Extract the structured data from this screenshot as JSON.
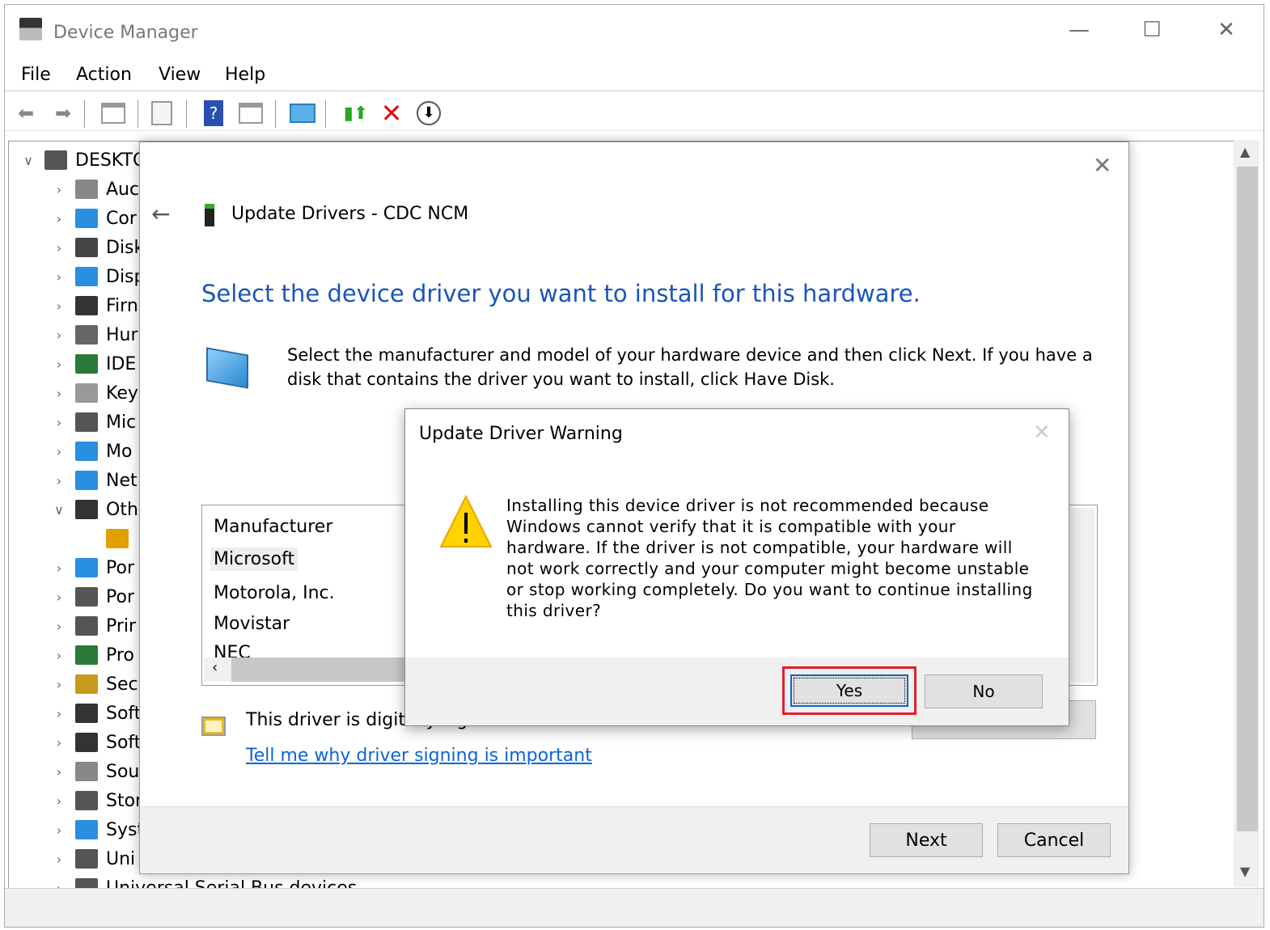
{
  "window": {
    "title": "Device Manager",
    "minimize": "—",
    "maximize": "☐",
    "close": "✕"
  },
  "menu": [
    "File",
    "Action",
    "View",
    "Help"
  ],
  "toolbar": {
    "icons": [
      "back-icon",
      "forward-icon",
      "show-hide-console-tree-icon",
      "properties-icon",
      "help-icon",
      "action-pane-icon",
      "scan-hardware-icon",
      "update-driver-icon",
      "uninstall-device-icon",
      "disable-device-icon"
    ]
  },
  "tree": {
    "root": "DESKTO",
    "items": [
      {
        "label": "Auc",
        "icon": "audio-icon",
        "color": "#888",
        "expanded": false
      },
      {
        "label": "Cor",
        "icon": "computer-icon",
        "color": "#2a8fe0",
        "expanded": false
      },
      {
        "label": "Disk",
        "icon": "disk-icon",
        "color": "#444",
        "expanded": false
      },
      {
        "label": "Disp",
        "icon": "display-icon",
        "color": "#2a8fe0",
        "expanded": false
      },
      {
        "label": "Firn",
        "icon": "firmware-icon",
        "color": "#333",
        "expanded": false
      },
      {
        "label": "Hur",
        "icon": "hid-icon",
        "color": "#666",
        "expanded": false
      },
      {
        "label": "IDE",
        "icon": "ide-icon",
        "color": "#2a7a3a",
        "expanded": false
      },
      {
        "label": "Key",
        "icon": "keyboard-icon",
        "color": "#999",
        "expanded": false
      },
      {
        "label": "Mic",
        "icon": "mouse-icon",
        "color": "#555",
        "expanded": false
      },
      {
        "label": "Mo",
        "icon": "monitor-icon",
        "color": "#2a8fe0",
        "expanded": false
      },
      {
        "label": "Net",
        "icon": "network-icon",
        "color": "#2a8fe0",
        "expanded": false
      },
      {
        "label": "Oth",
        "icon": "other-devices-icon",
        "color": "#333",
        "expanded": true
      },
      {
        "label": "",
        "icon": "unknown-device-warning-icon",
        "color": "#e0a000",
        "child": true
      },
      {
        "label": "Por",
        "icon": "portable-device-icon",
        "color": "#2a8fe0",
        "expanded": false
      },
      {
        "label": "Por",
        "icon": "port-icon",
        "color": "#555",
        "expanded": false
      },
      {
        "label": "Prir",
        "icon": "printer-icon",
        "color": "#555",
        "expanded": false
      },
      {
        "label": "Pro",
        "icon": "processor-icon",
        "color": "#2a7a3a",
        "expanded": false
      },
      {
        "label": "Sec",
        "icon": "security-icon",
        "color": "#c89a20",
        "expanded": false
      },
      {
        "label": "Soft",
        "icon": "software-component-icon",
        "color": "#333",
        "expanded": false
      },
      {
        "label": "Soft",
        "icon": "software-device-icon",
        "color": "#333",
        "expanded": false
      },
      {
        "label": "Sou",
        "icon": "sound-icon",
        "color": "#888",
        "expanded": false
      },
      {
        "label": "Stor",
        "icon": "storage-icon",
        "color": "#555",
        "expanded": false
      },
      {
        "label": "Syst",
        "icon": "system-icon",
        "color": "#2a8fe0",
        "expanded": false
      },
      {
        "label": "Uni",
        "icon": "usb-icon",
        "color": "#555",
        "expanded": false
      },
      {
        "label": "Universal Serial Bus devices",
        "icon": "usb-device-icon",
        "color": "#555",
        "expanded": false
      }
    ]
  },
  "update_dialog": {
    "title": "Update Drivers - CDC NCM",
    "heading": "Select the device driver you want to install for this hardware.",
    "instructions": "Select the manufacturer and model of your hardware device and then click Next. If you have a disk that contains the driver you want to install, click Have Disk.",
    "list_header": "Manufacturer",
    "manufacturers": [
      "Microsoft",
      "Motorola, Inc.",
      "Movistar",
      "NEC"
    ],
    "selected": "Microsoft",
    "signed_text": "This driver is digitally signed.",
    "signing_link": "Tell me why driver signing is important",
    "next": "Next",
    "cancel": "Cancel"
  },
  "warning_dialog": {
    "title": "Update Driver Warning",
    "message": "Installing this device driver is not recommended because Windows cannot verify that it is compatible with your hardware.  If the driver is not compatible, your hardware will not work correctly and your computer might become unstable or stop working completely.  Do you want to continue installing this driver?",
    "yes": "Yes",
    "no": "No",
    "highlight_color": "#e0202a",
    "accent": "#0a64d8",
    "heading_color": "#1a55b8"
  }
}
